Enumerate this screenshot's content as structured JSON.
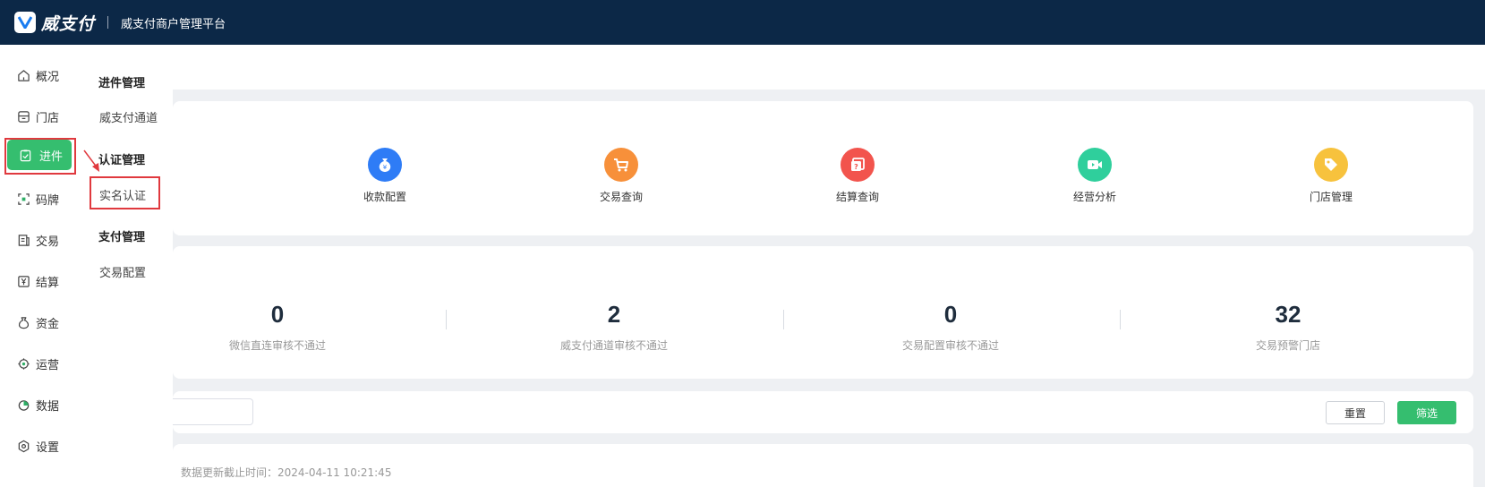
{
  "header": {
    "logo_text": "威支付",
    "platform_title": "威支付商户管理平台"
  },
  "rail": {
    "items": [
      {
        "label": "概况",
        "icon": "home-icon"
      },
      {
        "label": "门店",
        "icon": "store-icon"
      },
      {
        "label": "进件",
        "icon": "clipboard-icon",
        "active": true
      },
      {
        "label": "码牌",
        "icon": "qrcode-icon"
      },
      {
        "label": "交易",
        "icon": "document-icon"
      },
      {
        "label": "结算",
        "icon": "yen-icon"
      },
      {
        "label": "资金",
        "icon": "moneybag-icon"
      },
      {
        "label": "运营",
        "icon": "operation-icon"
      },
      {
        "label": "数据",
        "icon": "pie-chart-icon"
      },
      {
        "label": "设置",
        "icon": "settings-icon"
      }
    ]
  },
  "submenu": {
    "groups": [
      {
        "title": "进件管理",
        "items": [
          "威支付通道"
        ]
      },
      {
        "title": "认证管理",
        "items": [
          "实名认证"
        ]
      },
      {
        "title": "支付管理",
        "items": [
          "交易配置"
        ]
      }
    ]
  },
  "quick_actions": [
    {
      "label": "收款配置",
      "icon": "moneybag-icon",
      "color": "#2e7cf6"
    },
    {
      "label": "交易查询",
      "icon": "cart-icon",
      "color": "#f7903a"
    },
    {
      "label": "结算查询",
      "icon": "question-card-icon",
      "color": "#f2544d"
    },
    {
      "label": "经营分析",
      "icon": "video-icon",
      "color": "#2fcf9c"
    },
    {
      "label": "门店管理",
      "icon": "tag-icon",
      "color": "#f7c23d"
    }
  ],
  "stats": [
    {
      "value": "0",
      "label": "微信直连审核不通过"
    },
    {
      "value": "2",
      "label": "威支付通道审核不通过"
    },
    {
      "value": "0",
      "label": "交易配置审核不通过"
    },
    {
      "value": "32",
      "label": "交易预警门店"
    }
  ],
  "filter": {
    "reset_label": "重置",
    "filter_label": "筛选"
  },
  "list": {
    "update_time_text": "数据更新截止时间：2024-04-11 10:21:45"
  },
  "colors": {
    "topbar": "#0c2847",
    "accent": "#35be6f",
    "highlight": "#e0393e"
  }
}
